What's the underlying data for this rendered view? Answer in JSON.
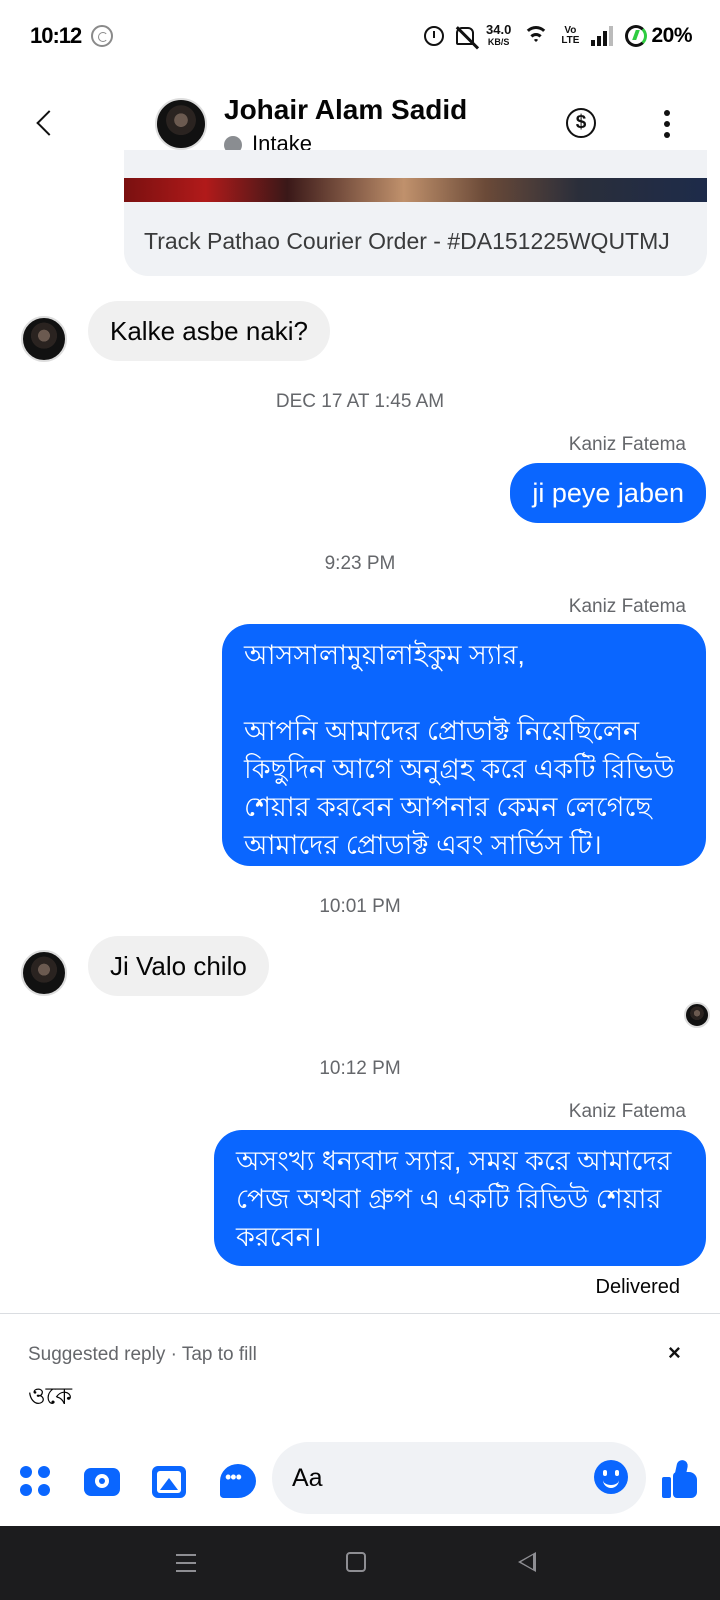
{
  "status_bar": {
    "time": "10:12",
    "speed_value": "34.0",
    "speed_unit": "KB/S",
    "volte_top": "Vo",
    "volte_bottom": "LTE",
    "battery": "20%"
  },
  "header": {
    "contact_name": "Johair Alam Sadid",
    "status": "Intake",
    "icons": [
      "back-icon",
      "dollar-icon",
      "more-icon"
    ]
  },
  "conversation": {
    "link_preview": {
      "title": "Track Pathao Courier Order - #DA151225WQUTMJ"
    },
    "msg_in_1": "Kalke asbe naki?",
    "stamp_1": "DEC 17 AT 1:45 AM",
    "sender_1": "Kaniz Fatema",
    "msg_out_1": "ji peye jaben",
    "stamp_2": "9:23 PM",
    "sender_2": "Kaniz Fatema",
    "msg_out_2": "আসসালামুয়ালাইকুম স্যার,\n\n আপনি আমাদের প্রোডাক্ট নিয়েছিলেন\nকিছুদিন আগে অনুগ্রহ করে একটি রিভিউ\nশেয়ার করবেন আপনার কেমন লেগেছে\nআমাদের প্রোডাক্ট এবং সার্ভিস টি।",
    "stamp_3": "10:01 PM",
    "msg_in_2": "Ji Valo chilo",
    "stamp_4": "10:12 PM",
    "sender_3": "Kaniz Fatema",
    "msg_out_3": "অসংখ্য ধন্যবাদ স্যার, সময় করে আমাদের\nপেজ অথবা গ্রুপ এ একটি রিভিউ শেয়ার\nকরবেন।",
    "delivered": "Delivered"
  },
  "suggestion": {
    "label": "Suggested reply · Tap to fill",
    "text": "ওকে",
    "close": "×"
  },
  "composer": {
    "placeholder": "Aa",
    "icons": [
      "apps-icon",
      "camera-icon",
      "gallery-icon",
      "messenger-icon",
      "emoji-icon",
      "like-icon"
    ]
  },
  "colors": {
    "accent": "#0a66ff",
    "incoming_bubble": "#f0f0f0",
    "secondary_text": "#65676b"
  }
}
